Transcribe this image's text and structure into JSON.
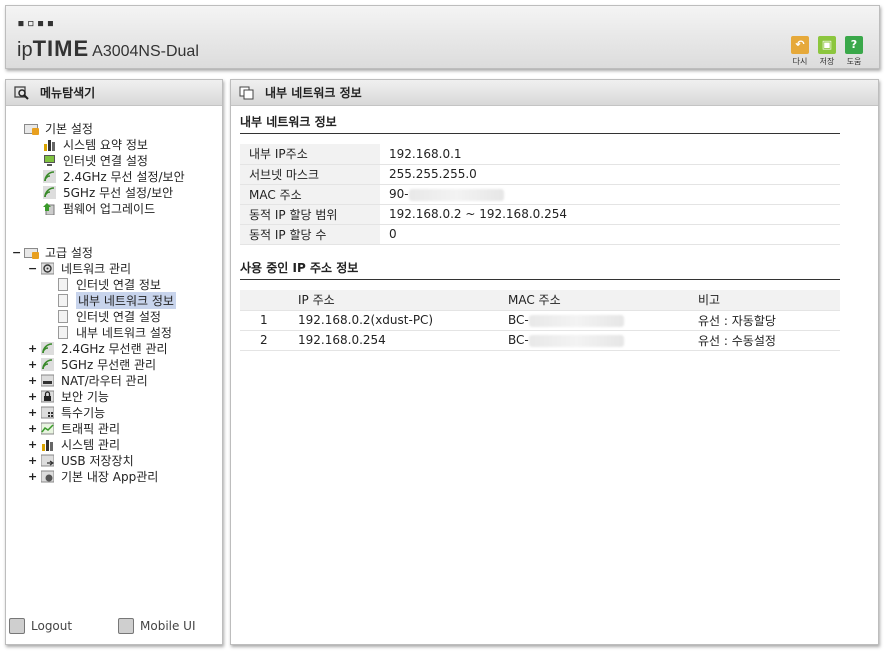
{
  "header": {
    "logo_dots": "▪▫▪▪",
    "brand_ip": "ip",
    "brand_time": "TIME",
    "model": "A3004NS-Dual",
    "buttons": [
      {
        "label": "다시",
        "icon": "undo-icon",
        "color": "#e6a93a"
      },
      {
        "label": "저장",
        "icon": "save-icon",
        "color": "#8cc63e"
      },
      {
        "label": "도움",
        "icon": "help-icon",
        "color": "#3aa84a",
        "glyph": "?"
      }
    ]
  },
  "left": {
    "title": "메뉴탐색기",
    "basic_group": "기본 설정",
    "basic_items": [
      "시스템 요약 정보",
      "인터넷 연결 설정",
      "2.4GHz 무선 설정/보안",
      "5GHz 무선 설정/보안",
      "펌웨어 업그레이드"
    ],
    "advanced_toggle": "−",
    "advanced_group": "고급 설정",
    "network_toggle": "−",
    "network_group": "네트워크 관리",
    "network_items": [
      "인터넷 연결 정보",
      "내부 네트워크 정보",
      "인터넷 연결 설정",
      "내부 네트워크 설정"
    ],
    "advanced_items": [
      "2.4GHz 무선랜 관리",
      "5GHz 무선랜 관리",
      "NAT/라우터 관리",
      "보안 기능",
      "특수기능",
      "트래픽 관리",
      "시스템 관리",
      "USB 저장장치",
      "기본 내장 App관리"
    ],
    "collapsed_toggle": "+",
    "logout": "Logout",
    "mobile": "Mobile UI"
  },
  "right": {
    "title": "내부 네트워크 정보",
    "section1": "내부 네트워크 정보",
    "info": [
      {
        "k": "내부 IP주소",
        "v": "192.168.0.1"
      },
      {
        "k": "서브넷 마스크",
        "v": "255.255.255.0"
      },
      {
        "k": "MAC 주소",
        "v": "90-"
      },
      {
        "k": "동적 IP 할당 범위",
        "v": "192.168.0.2 ~  192.168.0.254"
      },
      {
        "k": "동적 IP 할당 수",
        "v": "0"
      }
    ],
    "section2": "사용 중인 IP 주소 정보",
    "cols": [
      "IP 주소",
      "MAC 주소",
      "비고"
    ],
    "rows": [
      {
        "n": "1",
        "ip": "192.168.0.2(xdust-PC)",
        "mac": "BC-",
        "note": "유선 : 자동할당"
      },
      {
        "n": "2",
        "ip": "192.168.0.254",
        "mac": "BC-",
        "note": "유선 : 수동설정"
      }
    ]
  }
}
